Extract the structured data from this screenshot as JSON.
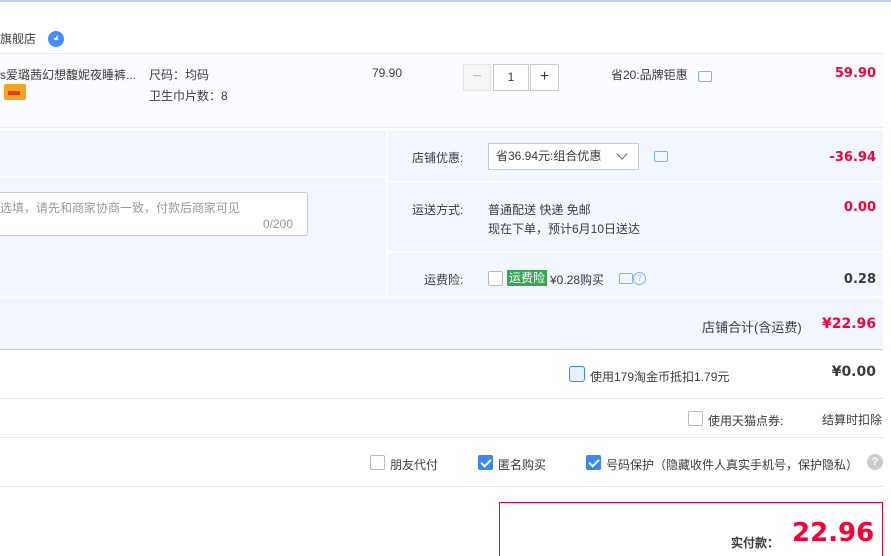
{
  "shop": {
    "name": "旗舰店"
  },
  "item": {
    "title": "s爱璐茜幻想馥妮夜睡裤...",
    "size": "尺码：均码",
    "pads": "卫生巾片数：8",
    "price": "79.90",
    "quantity": "1",
    "qty_minus": "−",
    "qty_plus": "+",
    "promo": "省20:品牌钜惠",
    "subtotal": "59.90"
  },
  "message": {
    "placeholder": "选填，请先和商家协商一致，付款后商家可见",
    "count": "0/200"
  },
  "shop_discount": {
    "label": "店铺优惠:",
    "selected": "省36.94元:组合优惠",
    "amount": "-36.94"
  },
  "shipping": {
    "label": "运送方式:",
    "method": "普通配送 快递 免邮",
    "eta": "现在下单，预计6月10日送达",
    "amount": "0.00"
  },
  "freight_insurance": {
    "label": "运费险:",
    "tag": "运费险",
    "price_text": "¥0.28购买",
    "help": "?",
    "amount": "0.28"
  },
  "shop_total": {
    "label": "店铺合计(含运费)",
    "amount": "¥22.96"
  },
  "taobao_coins": {
    "label": "使用179淘金币抵扣1.79元",
    "amount": "¥0.00"
  },
  "tmall_points": {
    "label": "使用天猫点券:",
    "note": "结算时扣除"
  },
  "options": {
    "friend_pay": "朋友代付",
    "anonymous": "匿名购买",
    "number_protect": "号码保护（隐藏收件人真实手机号，保护隐私）",
    "help": "?"
  },
  "pay": {
    "label": "实付款：",
    "amount": "22.96"
  },
  "colors": {
    "accent_red": "#ff0036",
    "panel_blue": "#f2f7ff",
    "check_blue": "#3b86f5",
    "freight_green": "#36a751"
  }
}
